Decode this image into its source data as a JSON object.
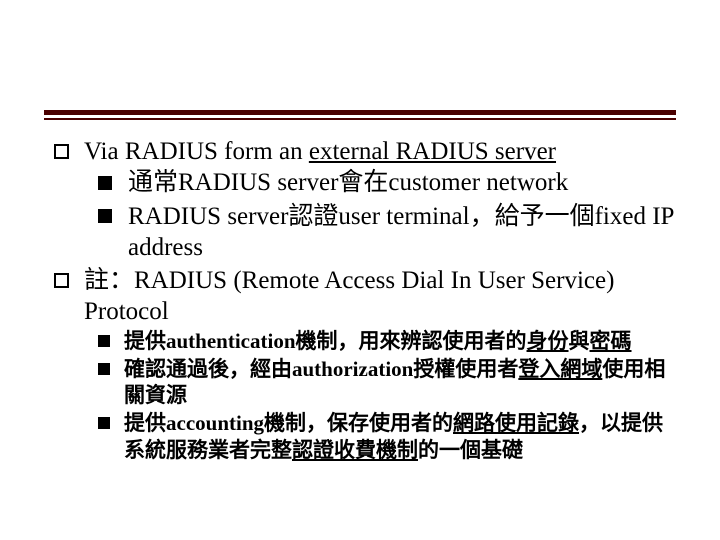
{
  "bullets": {
    "b1": {
      "pre": "Via RADIUS form an ",
      "u": "external RADIUS server",
      "sub1": "通常RADIUS server會在customer network",
      "sub2": "RADIUS server認證user terminal，給予一個fixed IP address"
    },
    "b2": {
      "text": "註：RADIUS (Remote Access Dial In User Service) Protocol",
      "s1": {
        "pre": "提供authentication機制，用來辨認使用者的",
        "u1": "身份",
        "mid": "與",
        "u2": "密碼"
      },
      "s2": {
        "pre": "確認通過後，經由authorization授權使用者",
        "u": "登入網域",
        "post": "使用相關資源"
      },
      "s3": {
        "pre": "提供accounting機制，保存使用者的",
        "u1": "網路使用記錄",
        "mid": "，以提供系統服務業者完整",
        "u2": "認證收費機制",
        "post": "的一個基礎"
      }
    }
  }
}
